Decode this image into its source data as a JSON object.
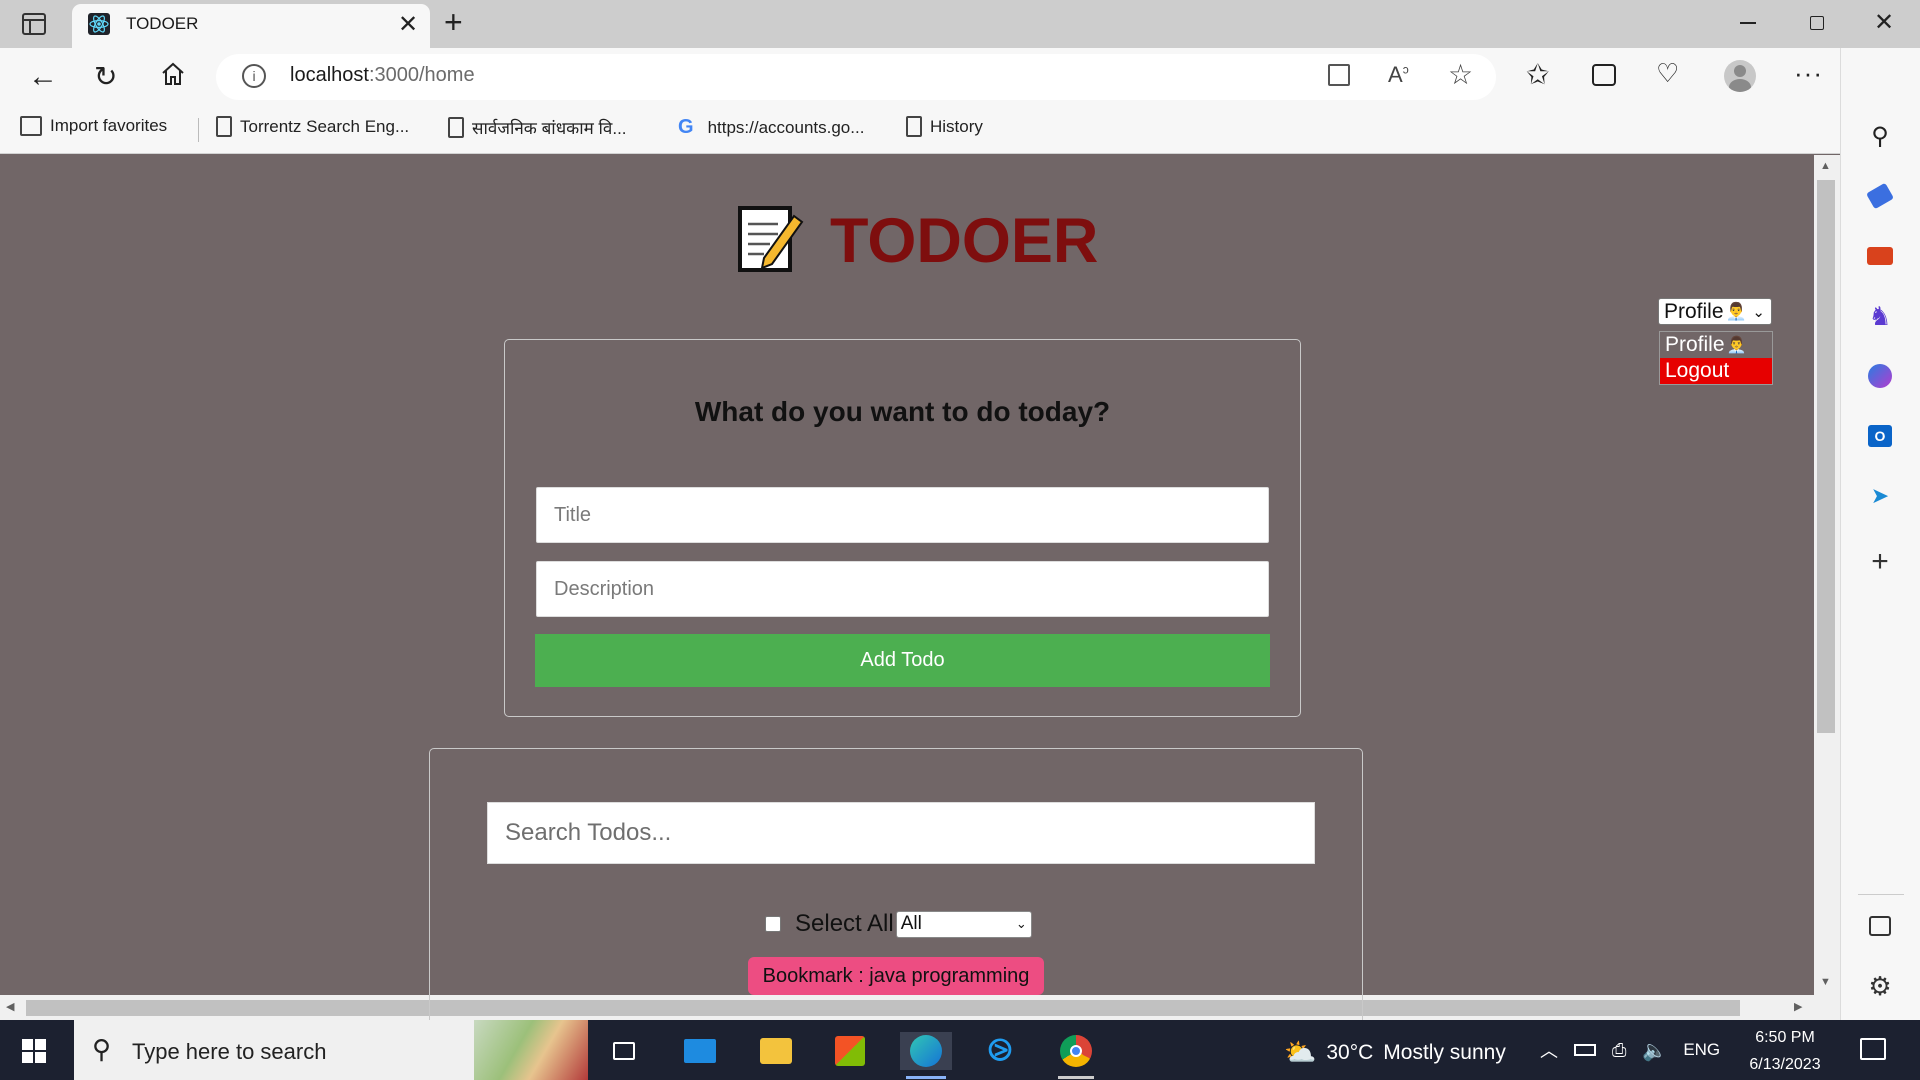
{
  "browser": {
    "tab_title": "TODOER",
    "url_host": "localhost",
    "url_path": ":3000/home",
    "favorites": [
      {
        "label": "Import favorites",
        "icon": "import-icon"
      },
      {
        "label": "Torrentz Search Eng...",
        "icon": "page-icon"
      },
      {
        "label": "सार्वजनिक बांधकाम वि...",
        "icon": "page-icon"
      },
      {
        "label": "https://accounts.go...",
        "icon": "google-icon"
      },
      {
        "label": "History",
        "icon": "page-icon"
      }
    ]
  },
  "app": {
    "title": "TODOER",
    "logo_icon": "notepad-pencil-icon",
    "form_heading": "What do you want to do today?",
    "title_placeholder": "Title",
    "description_placeholder": "Description",
    "add_button_label": "Add Todo",
    "search_placeholder": "Search Todos...",
    "select_all_label": "Select All",
    "filter_selected": "All",
    "bookmark_label": "Bookmark : java programming",
    "profile_select_label": "Profile",
    "profile_menu": [
      {
        "label": "Profile"
      },
      {
        "label": "Logout"
      }
    ],
    "colors": {
      "page_bg": "#716667",
      "title": "#7e0e0e",
      "add_button": "#4caf50",
      "bookmark": "#ed4d82",
      "logout": "#e60000"
    }
  },
  "taskbar": {
    "search_placeholder": "Type here to search",
    "weather_temp": "30°C",
    "weather_text": "Mostly sunny",
    "language": "ENG",
    "time": "6:50 PM",
    "date": "6/13/2023"
  }
}
